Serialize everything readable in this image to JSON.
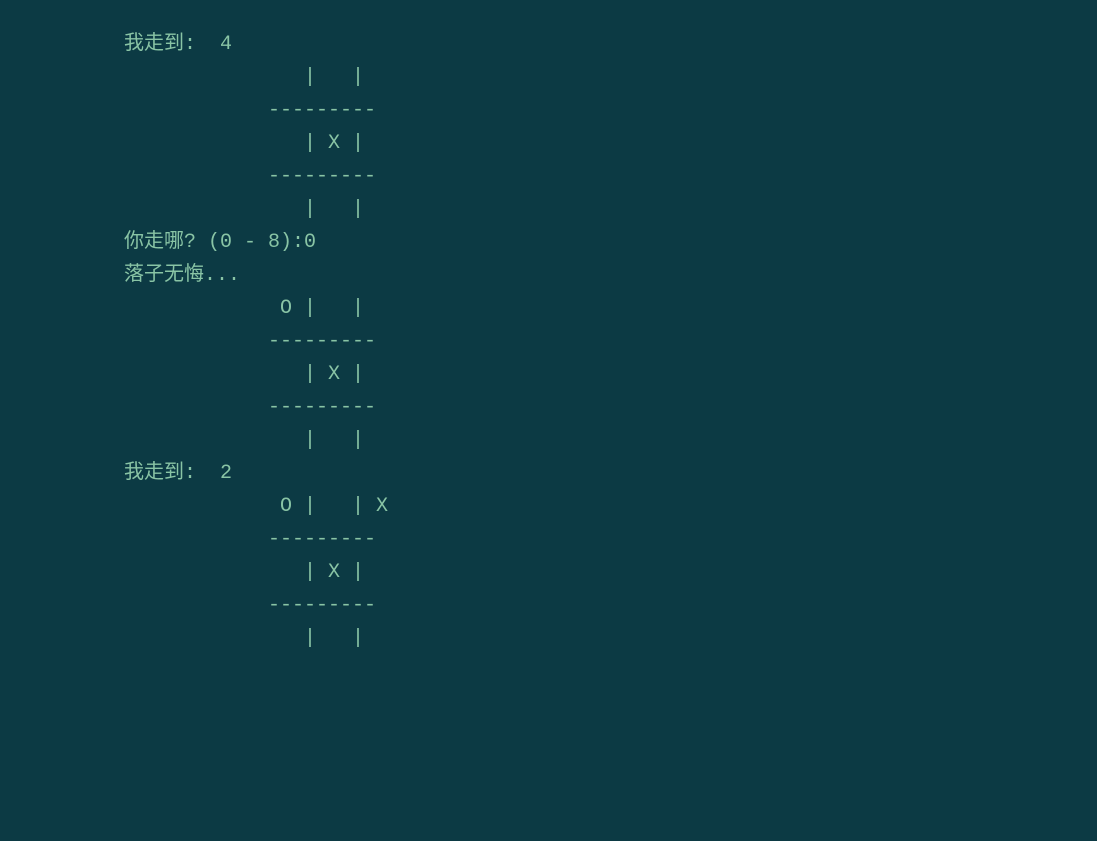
{
  "terminal": {
    "lines": [
      "我走到:  4",
      "",
      "               |   |",
      "            ---------",
      "               | X |",
      "            ---------",
      "               |   |",
      "",
      "你走哪? (0 - 8):0",
      "落子无悔...",
      "",
      "             O |   |",
      "            ---------",
      "               | X |",
      "            ---------",
      "               |   |",
      "",
      "我走到:  2",
      "",
      "             O |   | X",
      "            ---------",
      "               | X |",
      "            ---------",
      "               |   |",
      ""
    ]
  },
  "game": {
    "type": "tic-tac-toe",
    "computer_move_label": "我走到:",
    "player_prompt": "你走哪? (0 - 8):",
    "no_regret_label": "落子无悔...",
    "moves": [
      {
        "player": "computer",
        "position": 4,
        "symbol": "X"
      },
      {
        "player": "human",
        "position": 0,
        "symbol": "O"
      },
      {
        "player": "computer",
        "position": 2,
        "symbol": "X"
      }
    ],
    "boards": [
      {
        "after_move": 4,
        "cells": [
          "",
          "",
          "",
          "",
          "X",
          "",
          "",
          "",
          ""
        ]
      },
      {
        "after_move": 0,
        "cells": [
          "O",
          "",
          "",
          "",
          "X",
          "",
          "",
          "",
          ""
        ]
      },
      {
        "after_move": 2,
        "cells": [
          "O",
          "",
          "X",
          "",
          "X",
          "",
          "",
          "",
          ""
        ]
      }
    ]
  }
}
